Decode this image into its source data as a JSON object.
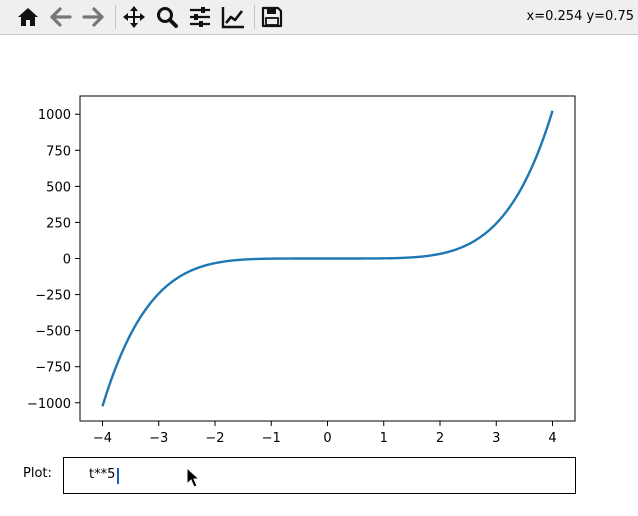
{
  "toolbar": {
    "buttons": [
      {
        "name": "home-button",
        "icon": "home-icon"
      },
      {
        "name": "back-button",
        "icon": "arrow-left-icon"
      },
      {
        "name": "forward-button",
        "icon": "arrow-right-icon"
      },
      {
        "name": "pan-button",
        "icon": "move-icon"
      },
      {
        "name": "zoom-button",
        "icon": "magnifier-icon"
      },
      {
        "name": "configure-subplots-button",
        "icon": "sliders-icon"
      },
      {
        "name": "edit-axes-button",
        "icon": "line-chart-icon"
      },
      {
        "name": "save-button",
        "icon": "floppy-disk-icon"
      }
    ],
    "coords": "x=0.254 y=0.75"
  },
  "textbox": {
    "label": "Plot:",
    "value": "t**5"
  },
  "chart_data": {
    "type": "line",
    "expression": "t**5",
    "x_range": [
      -4,
      4
    ],
    "xlim": [
      -4.4,
      4.4
    ],
    "ylim": [
      -1126.4,
      1126.4
    ],
    "xticks": [
      -4,
      -3,
      -2,
      -1,
      0,
      1,
      2,
      3,
      4
    ],
    "xtick_labels": [
      "−4",
      "−3",
      "−2",
      "−1",
      "0",
      "1",
      "2",
      "3",
      "4"
    ],
    "yticks": [
      -1000,
      -750,
      -500,
      -250,
      0,
      250,
      500,
      750,
      1000
    ],
    "ytick_labels": [
      "−1000",
      "−750",
      "−500",
      "−250",
      "0",
      "250",
      "500",
      "750",
      "1000"
    ],
    "grid": false,
    "series": [
      {
        "color": "#1f77b4",
        "x": [
          -4.0,
          -3.5,
          -3.0,
          -2.5,
          -2.0,
          -1.5,
          -1.0,
          -0.5,
          0.0,
          0.5,
          1.0,
          1.5,
          2.0,
          2.5,
          3.0,
          3.5,
          4.0
        ],
        "y": [
          -1024,
          -525.2,
          -243,
          -97.7,
          -32,
          -7.6,
          -1,
          -0.03,
          0,
          0.03,
          1,
          7.6,
          32,
          97.7,
          243,
          525.2,
          1024
        ]
      }
    ]
  }
}
